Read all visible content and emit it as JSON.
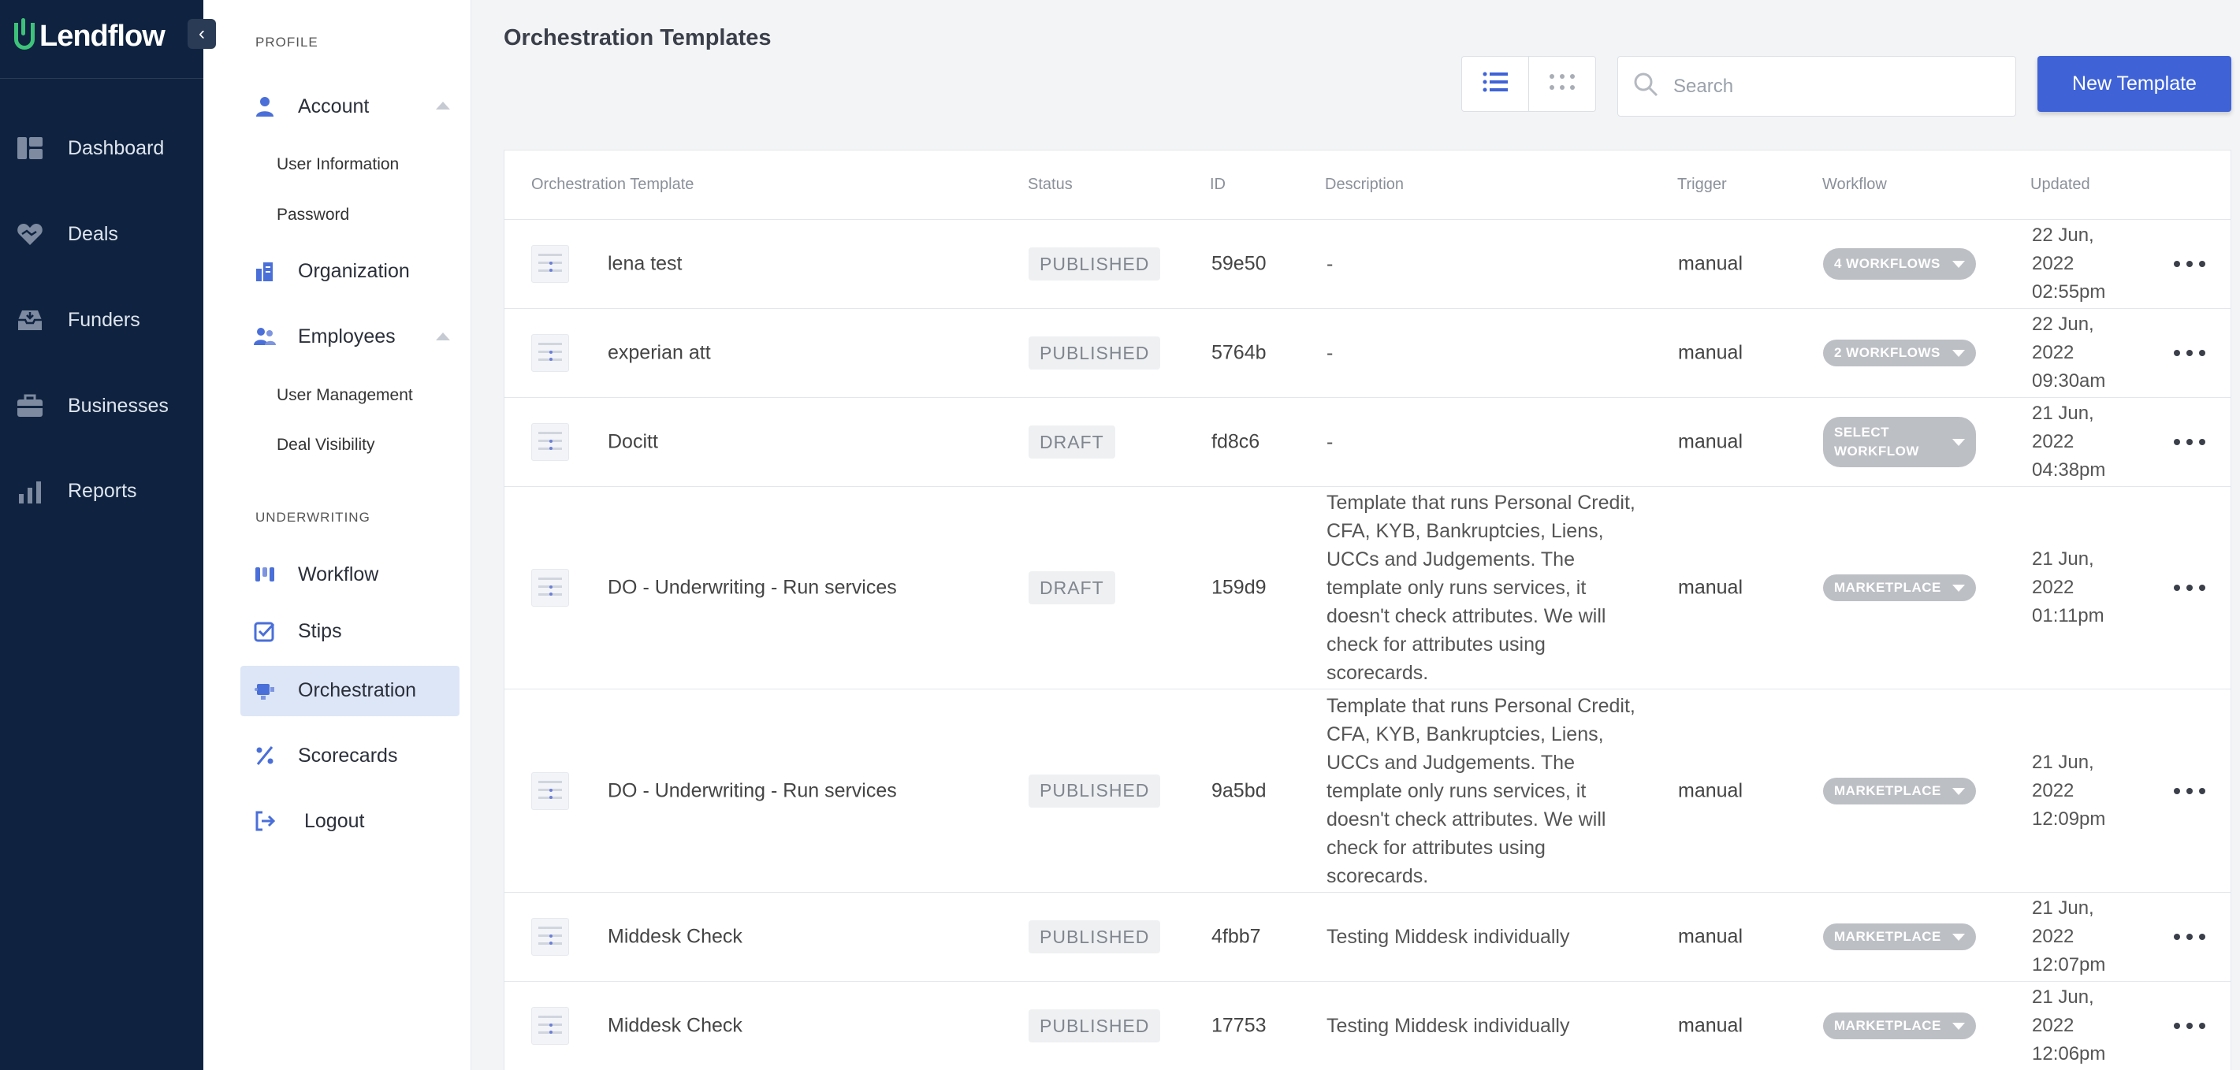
{
  "brand": {
    "name": "Lendflow",
    "accent": "#3ec27a"
  },
  "nav": {
    "items": [
      {
        "label": "Dashboard",
        "icon": "dashboard-icon"
      },
      {
        "label": "Deals",
        "icon": "handshake-heart-icon"
      },
      {
        "label": "Funders",
        "icon": "inbox-tray-icon"
      },
      {
        "label": "Businesses",
        "icon": "briefcase-icon"
      },
      {
        "label": "Reports",
        "icon": "bar-chart-icon"
      }
    ]
  },
  "sidebar": {
    "profile_title": "PROFILE",
    "account": "Account",
    "account_subs": [
      "User Information",
      "Password"
    ],
    "organization": "Organization",
    "employees": "Employees",
    "employees_subs": [
      "User Management",
      "Deal Visibility"
    ],
    "underwriting_title": "UNDERWRITING",
    "workflow": "Workflow",
    "stips": "Stips",
    "orchestration": "Orchestration",
    "scorecards": "Scorecards",
    "logout": "Logout",
    "active_color": "#dde6f6"
  },
  "main": {
    "title": "Orchestration Templates",
    "search_placeholder": "Search",
    "new_button": "New Template",
    "primary_color": "#3f63d6"
  },
  "table": {
    "columns": [
      "Orchestration Template",
      "Status",
      "ID",
      "Description",
      "Trigger",
      "Workflow",
      "Updated"
    ],
    "rows": [
      {
        "name": "lena test",
        "status": "PUBLISHED",
        "id": "59e50",
        "description": "-",
        "trigger": "manual",
        "workflow": "4 WORKFLOWS",
        "updated": "22 Jun, 2022 02:55pm"
      },
      {
        "name": "experian att",
        "status": "PUBLISHED",
        "id": "5764b",
        "description": "-",
        "trigger": "manual",
        "workflow": "2 WORKFLOWS",
        "updated": "22 Jun, 2022 09:30am"
      },
      {
        "name": "Docitt",
        "status": "DRAFT",
        "id": "fd8c6",
        "description": "-",
        "trigger": "manual",
        "workflow": "SELECT WORKFLOW",
        "updated": "21 Jun, 2022 04:38pm"
      },
      {
        "name": "DO - Underwriting - Run services",
        "status": "DRAFT",
        "id": "159d9",
        "description": "Template that runs Personal Credit, CFA, KYB, Bankruptcies, Liens, UCCs and Judgements. The template only runs services, it doesn't check attributes. We will check for attributes using scorecards.",
        "trigger": "manual",
        "workflow": "MARKETPLACE",
        "updated": "21 Jun, 2022 01:11pm"
      },
      {
        "name": "DO - Underwriting - Run services",
        "status": "PUBLISHED",
        "id": "9a5bd",
        "description": "Template that runs Personal Credit, CFA, KYB, Bankruptcies, Liens, UCCs and Judgements. The template only runs services, it doesn't check attributes. We will check for attributes using scorecards.",
        "trigger": "manual",
        "workflow": "MARKETPLACE",
        "updated": "21 Jun, 2022 12:09pm"
      },
      {
        "name": "Middesk Check",
        "status": "PUBLISHED",
        "id": "4fbb7",
        "description": "Testing Middesk individually",
        "trigger": "manual",
        "workflow": "MARKETPLACE",
        "updated": "21 Jun, 2022 12:07pm"
      },
      {
        "name": "Middesk Check",
        "status": "PUBLISHED",
        "id": "17753",
        "description": "Testing Middesk individually",
        "trigger": "manual",
        "workflow": "MARKETPLACE",
        "updated": "21 Jun, 2022 12:06pm"
      }
    ]
  }
}
